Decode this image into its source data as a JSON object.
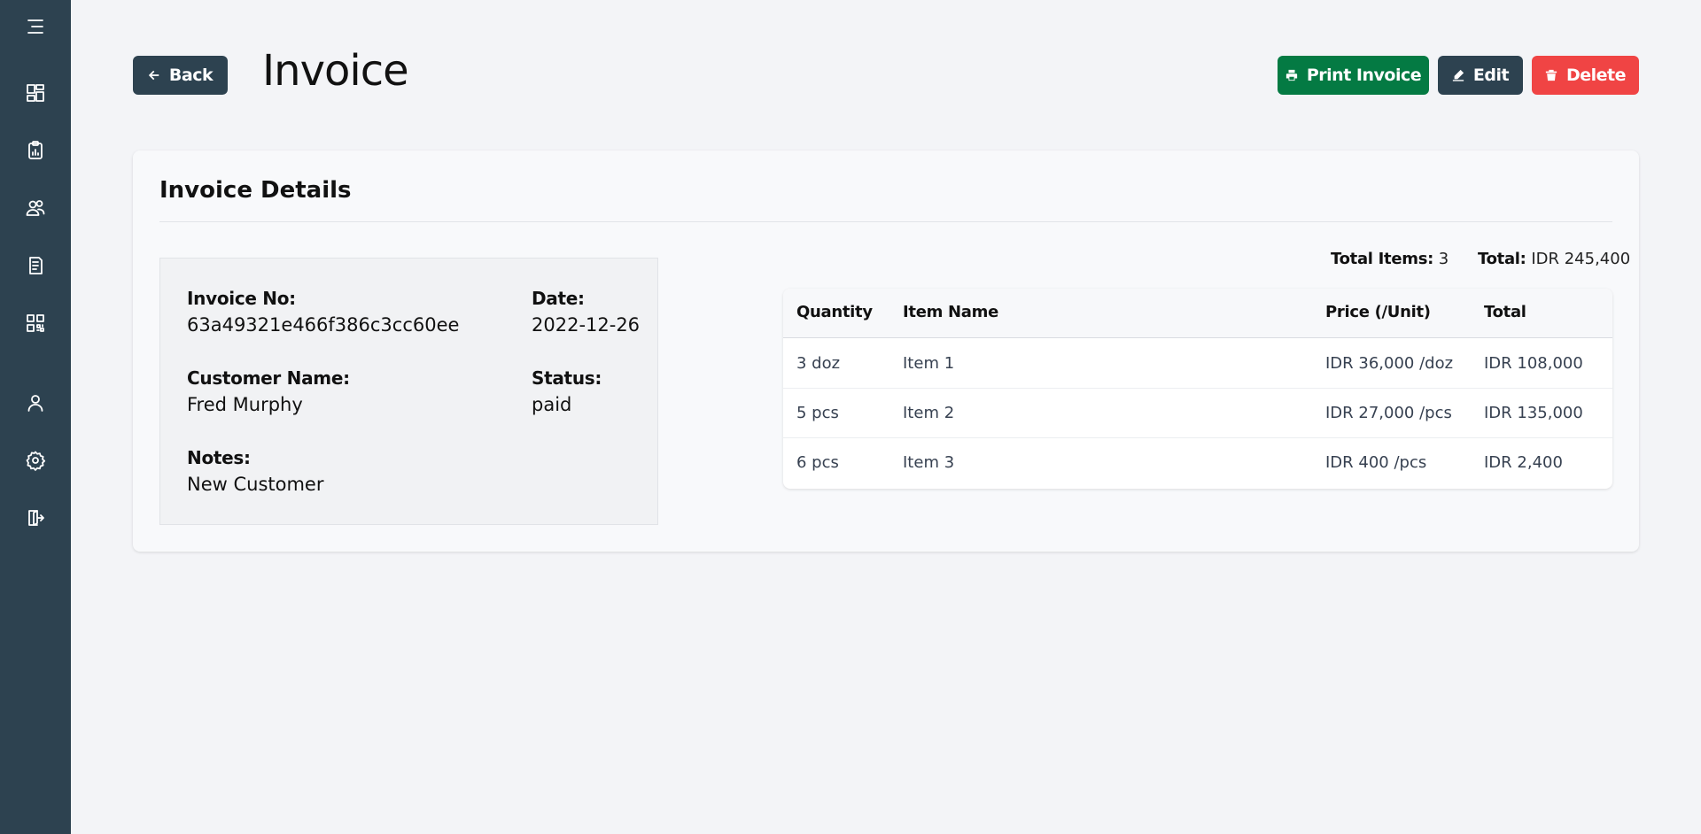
{
  "sidebar": {
    "items": [
      {
        "icon": "menu-icon"
      },
      {
        "icon": "dashboard-icon"
      },
      {
        "icon": "clipboard-chart-icon"
      },
      {
        "icon": "users-icon"
      },
      {
        "icon": "document-icon"
      },
      {
        "icon": "qr-code-icon"
      },
      {
        "icon": "user-icon"
      },
      {
        "icon": "settings-icon"
      },
      {
        "icon": "logout-icon"
      }
    ]
  },
  "header": {
    "back_label": "Back",
    "title": "Invoice",
    "print_label": "Print Invoice",
    "edit_label": "Edit",
    "delete_label": "Delete"
  },
  "colors": {
    "sidebar": "#2d4250",
    "print": "#047a43",
    "delete": "#f04444",
    "dark_button": "#2d4250"
  },
  "details": {
    "card_title": "Invoice Details",
    "invoice_no_label": "Invoice No:",
    "invoice_no": "63a49321e466f386c3cc60ee",
    "date_label": "Date:",
    "date": "2022-12-26",
    "customer_label": "Customer Name:",
    "customer": "Fred Murphy",
    "status_label": "Status:",
    "status": "paid",
    "notes_label": "Notes:",
    "notes": "New Customer"
  },
  "totals": {
    "items_label": "Total Items:",
    "items_value": "3",
    "total_label": "Total:",
    "total_value": "IDR 245,400"
  },
  "table": {
    "headers": [
      "Quantity",
      "Item Name",
      "Price (/Unit)",
      "Total"
    ],
    "rows": [
      [
        "3 doz",
        "Item 1",
        "IDR 36,000 /doz",
        "IDR 108,000"
      ],
      [
        "5 pcs",
        "Item 2",
        "IDR 27,000 /pcs",
        "IDR 135,000"
      ],
      [
        "6 pcs",
        "Item 3",
        "IDR 400 /pcs",
        "IDR 2,400"
      ]
    ]
  }
}
